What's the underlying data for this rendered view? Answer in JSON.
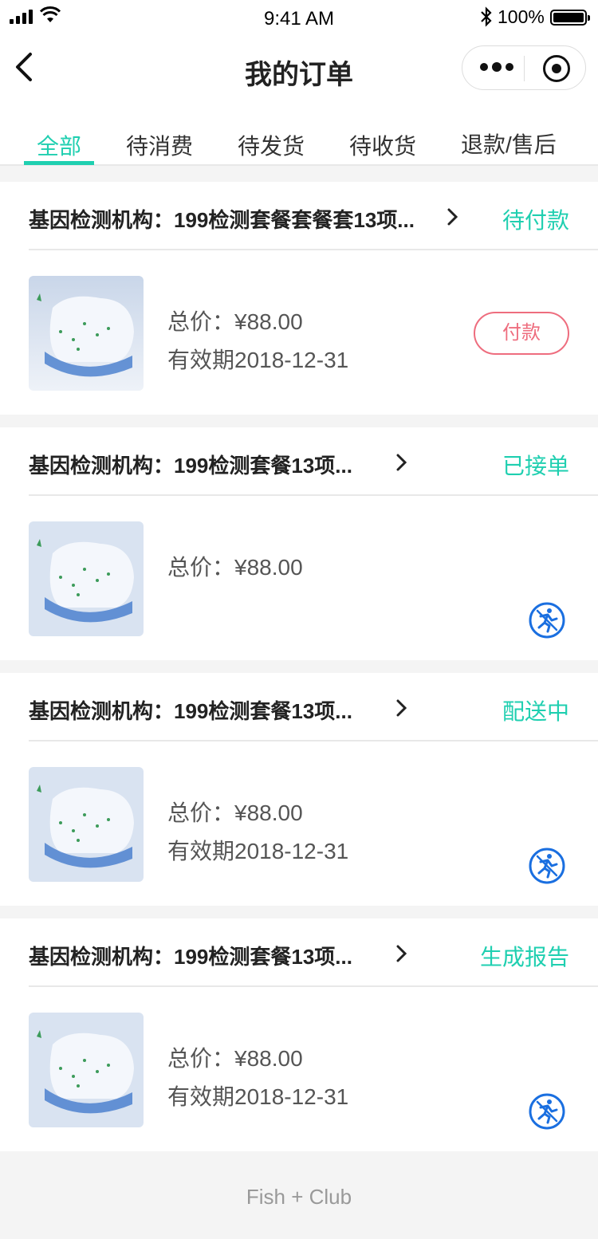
{
  "status_bar": {
    "time": "9:41 AM",
    "battery": "100%"
  },
  "nav": {
    "title": "我的订单"
  },
  "tabs": [
    {
      "label": "全部",
      "active": true
    },
    {
      "label": "待消费",
      "active": false
    },
    {
      "label": "待发货",
      "active": false
    },
    {
      "label": "待收货",
      "active": false
    },
    {
      "label": "退款/售后",
      "active": false
    }
  ],
  "orders": [
    {
      "shop": "基因检测机构：199检测套餐套餐套13项...",
      "status": "待付款",
      "price": "总价：¥88.00",
      "validity": "有效期2018-12-31",
      "action": "付款"
    },
    {
      "shop": "基因检测机构：199检测套餐13项...",
      "status": "已接单",
      "price": "总价：¥88.00",
      "validity": "",
      "action_icon": "courier-icon"
    },
    {
      "shop": "基因检测机构：199检测套餐13项...",
      "status": "配送中",
      "price": "总价：¥88.00",
      "validity": "有效期2018-12-31",
      "action_icon": "courier-icon"
    },
    {
      "shop": "基因检测机构：199检测套餐13项...",
      "status": "生成报告",
      "price": "总价：¥88.00",
      "validity": "有效期2018-12-31",
      "action_icon": "courier-icon"
    }
  ],
  "footer": {
    "brand": "Fish + Club"
  },
  "colors": {
    "accent": "#1fcfb0",
    "pay": "#ee6d7e",
    "icon_blue": "#1a6fe0",
    "background": "#f4f4f4"
  }
}
